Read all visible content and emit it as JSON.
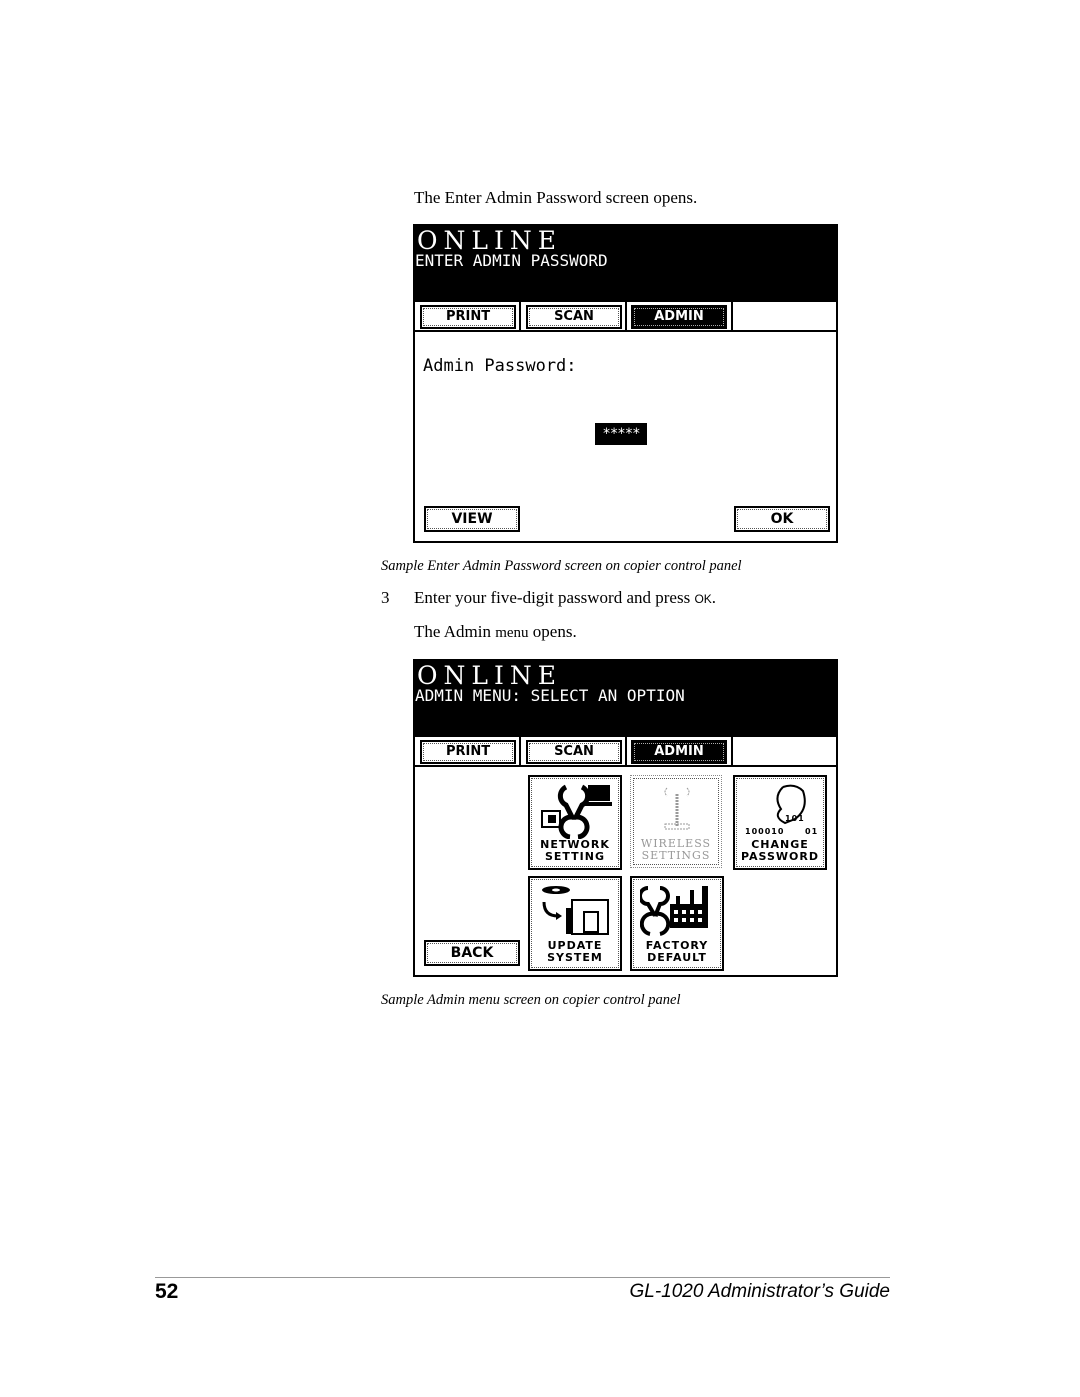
{
  "intro_text": "The Enter Admin Password screen opens.",
  "panel1": {
    "header_line1": "ONLINE",
    "header_line2": "ENTER ADMIN PASSWORD",
    "tabs": [
      "PRINT",
      "SCAN",
      "ADMIN"
    ],
    "active_tab": "ADMIN",
    "password_label": "Admin Password:",
    "password_value": "*****",
    "view_button": "VIEW",
    "ok_button": "OK"
  },
  "caption1": "Sample Enter Admin Password screen on copier control panel",
  "step": {
    "number": "3",
    "text": "Enter your five-digit password and press ",
    "key": "OK",
    "end": "."
  },
  "result_text": {
    "prefix": "The Admin ",
    "menu": "menu",
    "suffix": " opens."
  },
  "panel2": {
    "header_line1": "ONLINE",
    "header_line2": "ADMIN MENU: SELECT AN OPTION",
    "tabs": [
      "PRINT",
      "SCAN",
      "ADMIN"
    ],
    "active_tab": "ADMIN",
    "back_button": "BACK",
    "tiles": [
      {
        "line1": "NETWORK",
        "line2": "SETTING",
        "icon": "wrench-computer-icon",
        "enabled": true
      },
      {
        "line1": "WIRELESS",
        "line2": "SETTINGS",
        "icon": "antenna-icon",
        "enabled": false
      },
      {
        "line1": "CHANGE",
        "line2": "PASSWORD",
        "icon": "hand-binary-icon",
        "enabled": true
      },
      {
        "line1": "UPDATE",
        "line2": "SYSTEM",
        "icon": "disc-copier-icon",
        "enabled": true
      },
      {
        "line1": "FACTORY",
        "line2": "DEFAULT",
        "icon": "wrench-factory-icon",
        "enabled": true
      }
    ],
    "binary_text_left": "100010",
    "binary_text_right": "01",
    "binary_text_top": "101"
  },
  "caption2": "Sample Admin menu screen on copier control panel",
  "footer": {
    "page_number": "52",
    "title": "GL-1020 Administrator’s Guide"
  }
}
